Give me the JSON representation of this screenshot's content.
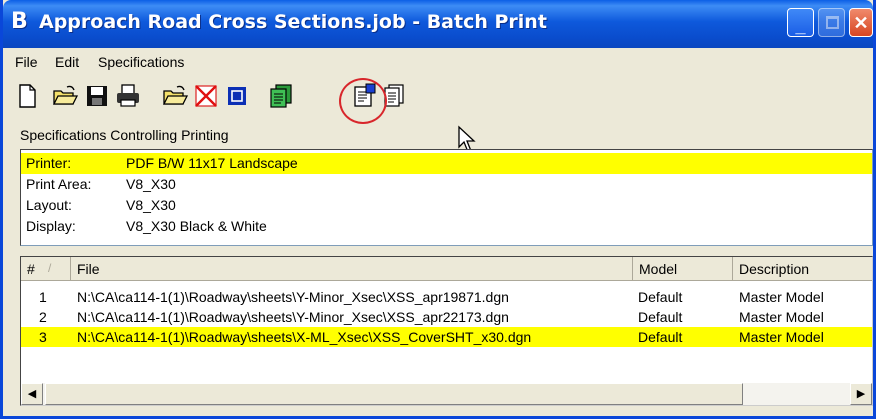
{
  "window": {
    "title": "Approach Road Cross Sections.job - Batch Print",
    "app_icon": "bentley-b-icon"
  },
  "menu": [
    {
      "label": "File"
    },
    {
      "label": "Edit"
    },
    {
      "label": "Specifications"
    }
  ],
  "toolbar": {
    "icons": [
      "new-icon",
      "open-icon",
      "save-icon",
      "print-icon",
      "open-job-icon",
      "delete-icon",
      "select-icon",
      "add-specification-icon",
      "properties-icon",
      "multiple-pages-icon"
    ]
  },
  "spec_section": {
    "label": "Specifications Controlling Printing",
    "rows": [
      {
        "key": "Printer:",
        "value": "PDF B/W 11x17 Landscape",
        "selected": true
      },
      {
        "key": "Print Area:",
        "value": "V8_X30",
        "selected": false
      },
      {
        "key": "Layout:",
        "value": "V8_X30",
        "selected": false
      },
      {
        "key": "Display:",
        "value": "V8_X30 Black & White",
        "selected": false
      }
    ]
  },
  "file_list": {
    "columns": [
      "#",
      "File",
      "Model",
      "Description"
    ],
    "sort_indicator": "/",
    "rows": [
      {
        "num": "1",
        "file": "N:\\CA\\ca114-1(1)\\Roadway\\sheets\\Y-Minor_Xsec\\XSS_apr19871.dgn",
        "model": "Default",
        "description": "Master Model",
        "selected": false
      },
      {
        "num": "2",
        "file": "N:\\CA\\ca114-1(1)\\Roadway\\sheets\\Y-Minor_Xsec\\XSS_apr22173.dgn",
        "model": "Default",
        "description": "Master Model",
        "selected": false
      },
      {
        "num": "3",
        "file": "N:\\CA\\ca114-1(1)\\Roadway\\sheets\\X-ML_Xsec\\XSS_CoverSHT_x30.dgn",
        "model": "Default",
        "description": "Master Model",
        "selected": true
      }
    ]
  },
  "colors": {
    "titlebar": "#0a4ccc",
    "selection": "#ffff00",
    "highlight_circle": "#d8262b"
  }
}
